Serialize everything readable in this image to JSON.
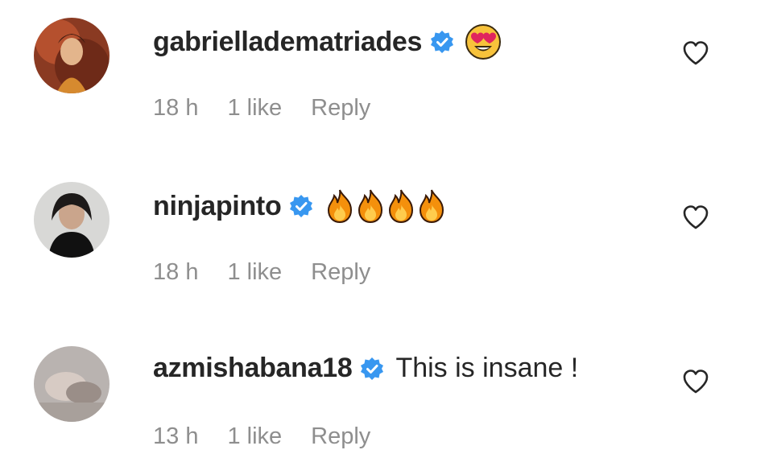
{
  "comments": [
    {
      "username": "gabrielladematriades",
      "text": "",
      "emoji": [
        "heart-eyes-emoji"
      ],
      "time": "18 h",
      "likes": "1 like",
      "reply": "Reply",
      "verified": true
    },
    {
      "username": "ninjapinto",
      "text": "",
      "emoji": [
        "fire-emoji",
        "fire-emoji",
        "fire-emoji",
        "fire-emoji"
      ],
      "time": "18 h",
      "likes": "1 like",
      "reply": "Reply",
      "verified": true
    },
    {
      "username": "azmishabana18",
      "text": "This is insane !",
      "emoji": [],
      "time": "13 h",
      "likes": "1 like",
      "reply": "Reply",
      "verified": true
    }
  ],
  "colors": {
    "verified": "#3897f0",
    "meta_text": "#8e8e8e",
    "username": "#262626"
  }
}
